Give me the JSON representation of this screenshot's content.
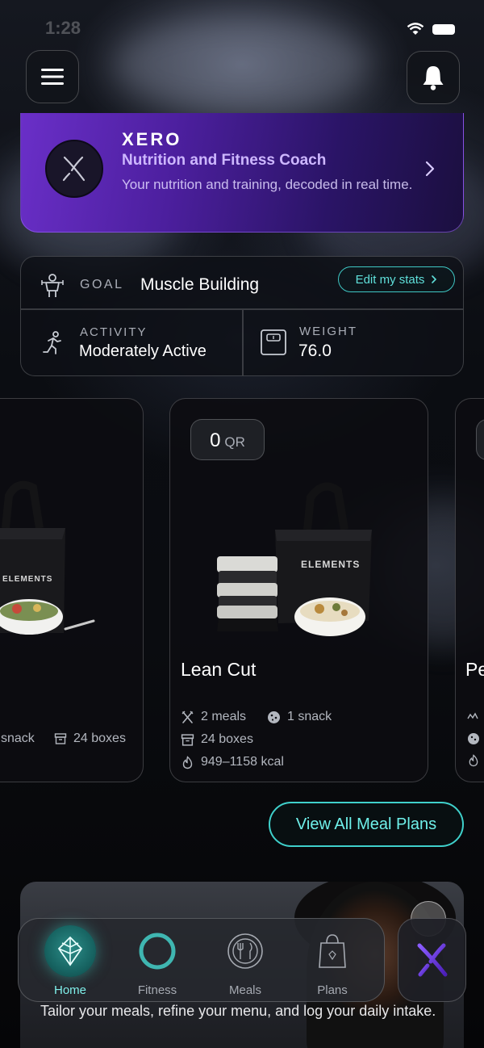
{
  "status_bar": {
    "time": "1:28"
  },
  "coach": {
    "name": "XERO",
    "role": "Nutrition and Fitness Coach",
    "description": "Your nutrition and training, decoded in real time."
  },
  "stats": {
    "goal_label": "GOAL",
    "goal_value": "Muscle Building",
    "edit_label": "Edit my stats",
    "activity_label": "ACTIVITY",
    "activity_value": "Moderately Active",
    "weight_label": "WEIGHT",
    "weight_value": "76.0"
  },
  "plans": {
    "left": {
      "snack_text": "snack",
      "boxes_text": "24 boxes"
    },
    "center": {
      "price_value": "0",
      "price_unit": "QR",
      "title": "Lean Cut",
      "meals": "2 meals",
      "snacks": "1 snack",
      "boxes": "24 boxes",
      "kcal": "949–1158 kcal"
    },
    "right": {
      "title": "Pe"
    },
    "bag_brand": "ELEMENTS"
  },
  "view_all_label": "View All Meal Plans",
  "promo": {
    "text": "Tailor your meals, refine your menu, and log your daily intake."
  },
  "nav": {
    "items": [
      {
        "label": "Home",
        "icon": "home-leaf-icon",
        "active": true
      },
      {
        "label": "Fitness",
        "icon": "fitness-ring-icon",
        "active": false
      },
      {
        "label": "Meals",
        "icon": "meals-plate-icon",
        "active": false
      },
      {
        "label": "Plans",
        "icon": "plans-bag-icon",
        "active": false
      }
    ],
    "fab_icon": "xero-x-icon"
  },
  "colors": {
    "accent_teal": "#3fd0cb",
    "coach_purple": "#6a2fc8",
    "background": "#07080b"
  }
}
